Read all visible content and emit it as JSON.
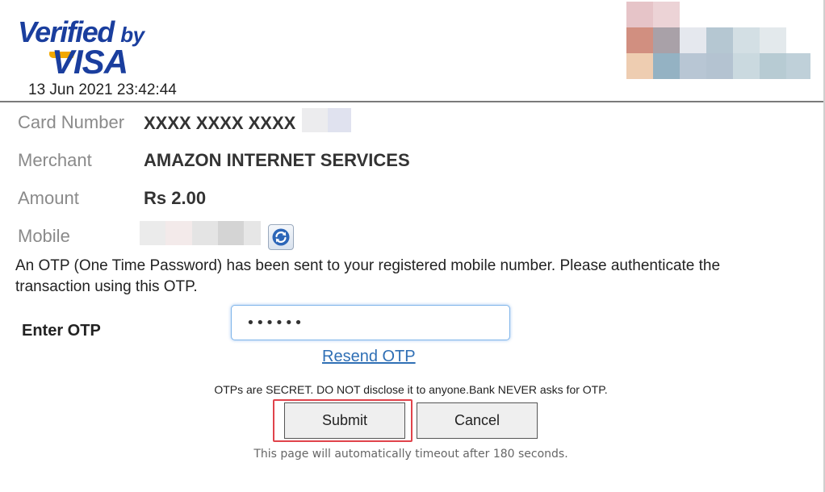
{
  "header": {
    "visa_verified_text": "Verified",
    "visa_by_text": "by",
    "visa_word": "VISA",
    "timestamp": "13 Jun 2021 23:42:44"
  },
  "details": {
    "card_number_label": "Card Number",
    "card_number_value": "XXXX XXXX XXXX",
    "merchant_label": "Merchant",
    "merchant_value": "AMAZON INTERNET SERVICES",
    "amount_label": "Amount",
    "amount_value": "Rs 2.00",
    "mobile_label": "Mobile"
  },
  "otp": {
    "message": "An OTP (One Time Password) has been sent to your registered mobile number. Please authenticate the transaction using this OTP.",
    "label": "Enter OTP",
    "input_value": "••••••",
    "resend_label": "Resend OTP",
    "secret_note": "OTPs are SECRET. DO NOT disclose it to anyone.Bank NEVER asks for OTP."
  },
  "actions": {
    "submit_label": "Submit",
    "cancel_label": "Cancel"
  },
  "footer": {
    "timeout_note": "This page will automatically timeout after 180 seconds."
  },
  "icons": {
    "refresh": "refresh-icon"
  },
  "colors": {
    "visa_blue": "#1a3e9e",
    "visa_gold": "#f2a800",
    "link_blue": "#2f6fb5",
    "highlight_red": "#e0434b"
  }
}
